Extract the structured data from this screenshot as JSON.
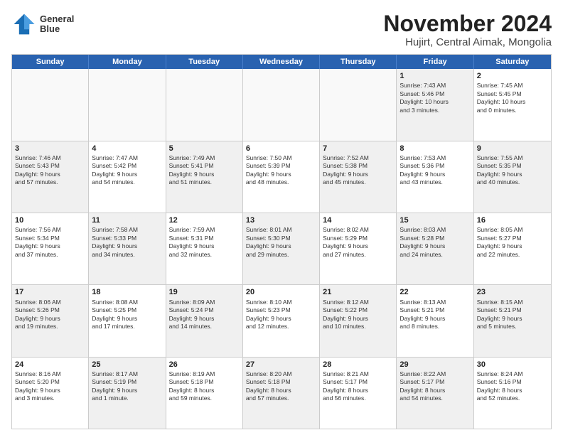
{
  "logo": {
    "line1": "General",
    "line2": "Blue"
  },
  "title": "November 2024",
  "location": "Hujirt, Central Aimak, Mongolia",
  "calendar": {
    "headers": [
      "Sunday",
      "Monday",
      "Tuesday",
      "Wednesday",
      "Thursday",
      "Friday",
      "Saturday"
    ],
    "rows": [
      [
        {
          "day": "",
          "info": "",
          "empty": true
        },
        {
          "day": "",
          "info": "",
          "empty": true
        },
        {
          "day": "",
          "info": "",
          "empty": true
        },
        {
          "day": "",
          "info": "",
          "empty": true
        },
        {
          "day": "",
          "info": "",
          "empty": true
        },
        {
          "day": "1",
          "info": "Sunrise: 7:43 AM\nSunset: 5:46 PM\nDaylight: 10 hours\nand 3 minutes.",
          "shaded": true
        },
        {
          "day": "2",
          "info": "Sunrise: 7:45 AM\nSunset: 5:45 PM\nDaylight: 10 hours\nand 0 minutes.",
          "shaded": false
        }
      ],
      [
        {
          "day": "3",
          "info": "Sunrise: 7:46 AM\nSunset: 5:43 PM\nDaylight: 9 hours\nand 57 minutes.",
          "shaded": true
        },
        {
          "day": "4",
          "info": "Sunrise: 7:47 AM\nSunset: 5:42 PM\nDaylight: 9 hours\nand 54 minutes.",
          "shaded": false
        },
        {
          "day": "5",
          "info": "Sunrise: 7:49 AM\nSunset: 5:41 PM\nDaylight: 9 hours\nand 51 minutes.",
          "shaded": true
        },
        {
          "day": "6",
          "info": "Sunrise: 7:50 AM\nSunset: 5:39 PM\nDaylight: 9 hours\nand 48 minutes.",
          "shaded": false
        },
        {
          "day": "7",
          "info": "Sunrise: 7:52 AM\nSunset: 5:38 PM\nDaylight: 9 hours\nand 45 minutes.",
          "shaded": true
        },
        {
          "day": "8",
          "info": "Sunrise: 7:53 AM\nSunset: 5:36 PM\nDaylight: 9 hours\nand 43 minutes.",
          "shaded": false
        },
        {
          "day": "9",
          "info": "Sunrise: 7:55 AM\nSunset: 5:35 PM\nDaylight: 9 hours\nand 40 minutes.",
          "shaded": true
        }
      ],
      [
        {
          "day": "10",
          "info": "Sunrise: 7:56 AM\nSunset: 5:34 PM\nDaylight: 9 hours\nand 37 minutes.",
          "shaded": false
        },
        {
          "day": "11",
          "info": "Sunrise: 7:58 AM\nSunset: 5:33 PM\nDaylight: 9 hours\nand 34 minutes.",
          "shaded": true
        },
        {
          "day": "12",
          "info": "Sunrise: 7:59 AM\nSunset: 5:31 PM\nDaylight: 9 hours\nand 32 minutes.",
          "shaded": false
        },
        {
          "day": "13",
          "info": "Sunrise: 8:01 AM\nSunset: 5:30 PM\nDaylight: 9 hours\nand 29 minutes.",
          "shaded": true
        },
        {
          "day": "14",
          "info": "Sunrise: 8:02 AM\nSunset: 5:29 PM\nDaylight: 9 hours\nand 27 minutes.",
          "shaded": false
        },
        {
          "day": "15",
          "info": "Sunrise: 8:03 AM\nSunset: 5:28 PM\nDaylight: 9 hours\nand 24 minutes.",
          "shaded": true
        },
        {
          "day": "16",
          "info": "Sunrise: 8:05 AM\nSunset: 5:27 PM\nDaylight: 9 hours\nand 22 minutes.",
          "shaded": false
        }
      ],
      [
        {
          "day": "17",
          "info": "Sunrise: 8:06 AM\nSunset: 5:26 PM\nDaylight: 9 hours\nand 19 minutes.",
          "shaded": true
        },
        {
          "day": "18",
          "info": "Sunrise: 8:08 AM\nSunset: 5:25 PM\nDaylight: 9 hours\nand 17 minutes.",
          "shaded": false
        },
        {
          "day": "19",
          "info": "Sunrise: 8:09 AM\nSunset: 5:24 PM\nDaylight: 9 hours\nand 14 minutes.",
          "shaded": true
        },
        {
          "day": "20",
          "info": "Sunrise: 8:10 AM\nSunset: 5:23 PM\nDaylight: 9 hours\nand 12 minutes.",
          "shaded": false
        },
        {
          "day": "21",
          "info": "Sunrise: 8:12 AM\nSunset: 5:22 PM\nDaylight: 9 hours\nand 10 minutes.",
          "shaded": true
        },
        {
          "day": "22",
          "info": "Sunrise: 8:13 AM\nSunset: 5:21 PM\nDaylight: 9 hours\nand 8 minutes.",
          "shaded": false
        },
        {
          "day": "23",
          "info": "Sunrise: 8:15 AM\nSunset: 5:21 PM\nDaylight: 9 hours\nand 5 minutes.",
          "shaded": true
        }
      ],
      [
        {
          "day": "24",
          "info": "Sunrise: 8:16 AM\nSunset: 5:20 PM\nDaylight: 9 hours\nand 3 minutes.",
          "shaded": false
        },
        {
          "day": "25",
          "info": "Sunrise: 8:17 AM\nSunset: 5:19 PM\nDaylight: 9 hours\nand 1 minute.",
          "shaded": true
        },
        {
          "day": "26",
          "info": "Sunrise: 8:19 AM\nSunset: 5:18 PM\nDaylight: 8 hours\nand 59 minutes.",
          "shaded": false
        },
        {
          "day": "27",
          "info": "Sunrise: 8:20 AM\nSunset: 5:18 PM\nDaylight: 8 hours\nand 57 minutes.",
          "shaded": true
        },
        {
          "day": "28",
          "info": "Sunrise: 8:21 AM\nSunset: 5:17 PM\nDaylight: 8 hours\nand 56 minutes.",
          "shaded": false
        },
        {
          "day": "29",
          "info": "Sunrise: 8:22 AM\nSunset: 5:17 PM\nDaylight: 8 hours\nand 54 minutes.",
          "shaded": true
        },
        {
          "day": "30",
          "info": "Sunrise: 8:24 AM\nSunset: 5:16 PM\nDaylight: 8 hours\nand 52 minutes.",
          "shaded": false
        }
      ]
    ]
  }
}
